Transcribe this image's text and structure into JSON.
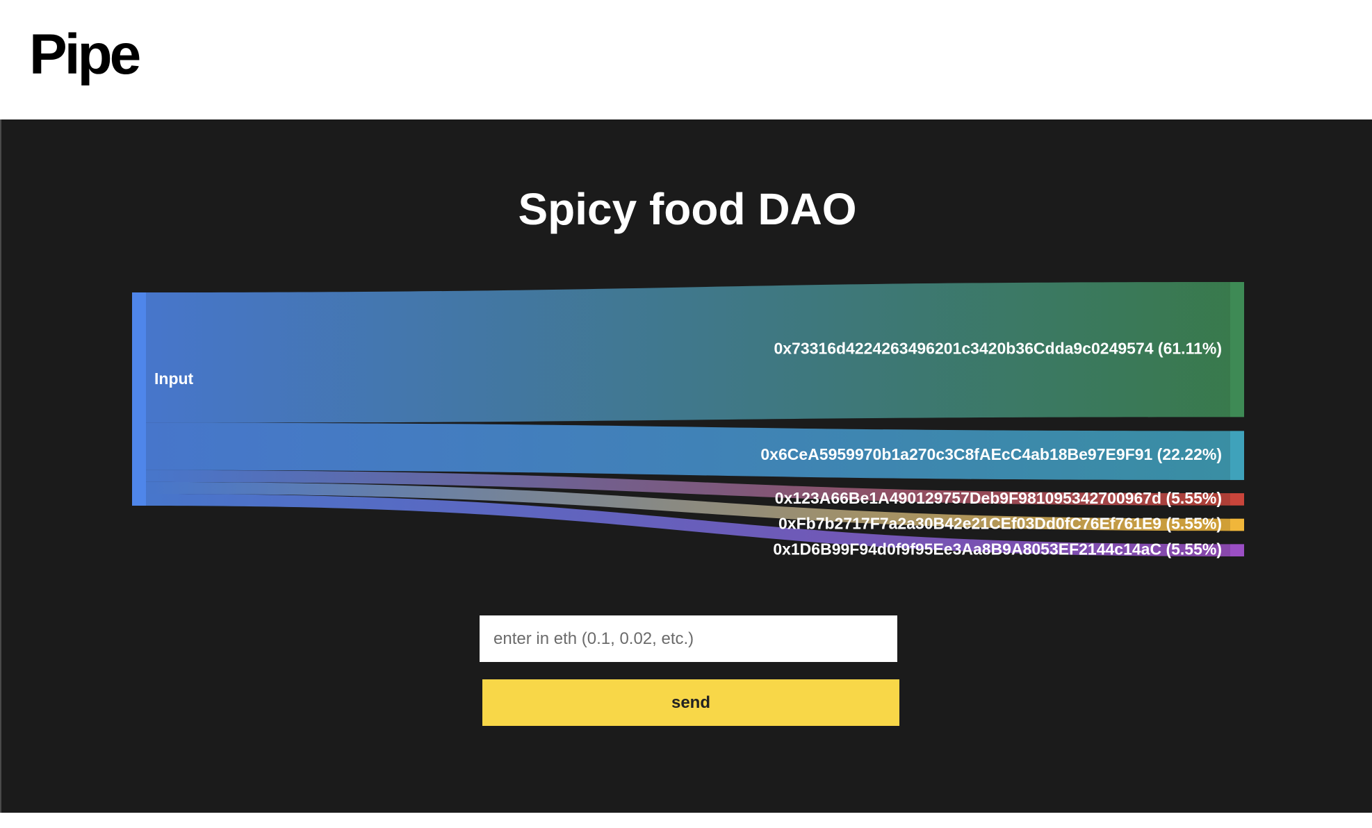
{
  "app": {
    "logo": "Pipe"
  },
  "dao": {
    "title": "Spicy food DAO"
  },
  "chart_data": {
    "type": "sankey",
    "source": {
      "label": "Input",
      "color": "#4f86ea"
    },
    "targets": [
      {
        "label": "0x73316d4224263496201c3420b36Cdda9c0249574 (61.11%)",
        "percent": 61.11,
        "color": "#3e8a55"
      },
      {
        "label": "0x6CeA5959970b1a270c3C8fAEcC4ab18Be97E9F91 (22.22%)",
        "percent": 22.22,
        "color": "#3fa2bb"
      },
      {
        "label": "0x123A66Be1A490129757Deb9F981095342700967d (5.55%)",
        "percent": 5.55,
        "color": "#c9453b"
      },
      {
        "label": "0xFb7b2717F7a2a30B42e21CEf03Dd0fC76Ef761E9 (5.55%)",
        "percent": 5.55,
        "color": "#f0b63a"
      },
      {
        "label": "0x1D6B99F94d0f9f95Ee3Aa8B9A8053EF2144c14aC (5.55%)",
        "percent": 5.55,
        "color": "#9b4fc4"
      }
    ]
  },
  "form": {
    "amount_placeholder": "enter in eth (0.1, 0.02, etc.)",
    "amount_value": "",
    "send_label": "send"
  }
}
